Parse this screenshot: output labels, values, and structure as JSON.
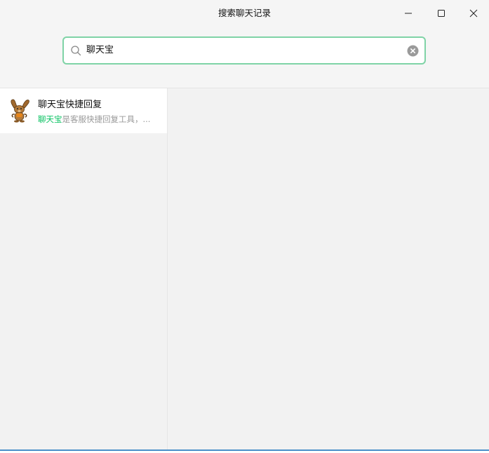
{
  "window": {
    "title": "搜索聊天记录",
    "controls": [
      "minimize-icon",
      "maximize-icon",
      "close-icon"
    ]
  },
  "search": {
    "value": "聊天宝",
    "icon": "search-icon",
    "clear_icon": "clear-circle-icon"
  },
  "results": [
    {
      "title": "聊天宝快捷回复",
      "snippet_highlight": "聊天宝",
      "snippet_rest": "是客服快捷回复工具，...",
      "avatar": "rabbit-avatar"
    }
  ],
  "colors": {
    "accent": "#07c160",
    "search_border": "#7fd3a6",
    "panel_bg": "#f2f2f2",
    "window_border": "#4a8fc9"
  }
}
